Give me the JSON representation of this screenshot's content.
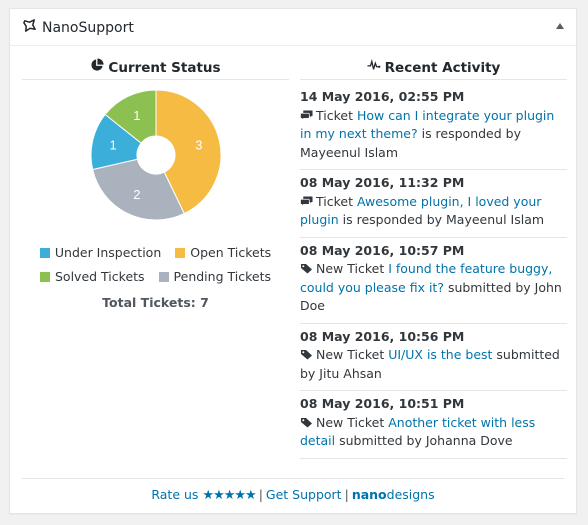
{
  "widget": {
    "title": "NanoSupport",
    "title_icon": "star-outline-icon",
    "toggle_icon": "triangle-up-icon"
  },
  "status": {
    "heading": "Current Status",
    "heading_icon": "pie-chart-icon",
    "total_label": "Total Tickets: 7"
  },
  "activity": {
    "heading": "Recent Activity",
    "heading_icon": "pulse-icon",
    "items": [
      {
        "date": "14 May 2016, 02:55 PM",
        "icon": "comments-icon",
        "prefix": "Ticket",
        "link": "How can I integrate your plugin in my next theme?",
        "suffix": "is responded by Mayeenul Islam"
      },
      {
        "date": "08 May 2016, 11:32 PM",
        "icon": "comments-icon",
        "prefix": "Ticket",
        "link": "Awesome plugin, I loved your plugin",
        "suffix": "is responded by Mayeenul Islam"
      },
      {
        "date": "08 May 2016, 10:57 PM",
        "icon": "tag-icon",
        "prefix": "New Ticket",
        "link": "I found the feature buggy, could you please fix it?",
        "suffix": "submitted by John Doe"
      },
      {
        "date": "08 May 2016, 10:56 PM",
        "icon": "tag-icon",
        "prefix": "New Ticket",
        "link": "UI/UX is the best",
        "suffix": "submitted by Jitu Ahsan"
      },
      {
        "date": "08 May 2016, 10:51 PM",
        "icon": "tag-icon",
        "prefix": "New Ticket",
        "link": "Another ticket with less detail",
        "suffix": "submitted by Johanna Dove"
      }
    ]
  },
  "footer": {
    "rate_label": "Rate us",
    "stars": "★★★★★",
    "separator": "|",
    "support_label": "Get Support",
    "brand_bold": "nano",
    "brand_rest": "designs"
  },
  "chart_data": {
    "type": "pie",
    "variant": "doughnut",
    "title": "Current Status",
    "categories": [
      "Open Tickets",
      "Pending Tickets",
      "Under Inspection",
      "Solved Tickets"
    ],
    "values": [
      3,
      2,
      1,
      1
    ],
    "colors": [
      "#f6bb42",
      "#aab2bd",
      "#3bafda",
      "#8cc152"
    ],
    "data_labels": [
      "3",
      "2",
      "1",
      "1"
    ],
    "legend": [
      {
        "label": "Under Inspection",
        "color": "#3bafda"
      },
      {
        "label": "Open Tickets",
        "color": "#f6bb42"
      },
      {
        "label": "Solved Tickets",
        "color": "#8cc152"
      },
      {
        "label": "Pending Tickets",
        "color": "#aab2bd"
      }
    ],
    "legend_position": "bottom",
    "total": 7
  }
}
